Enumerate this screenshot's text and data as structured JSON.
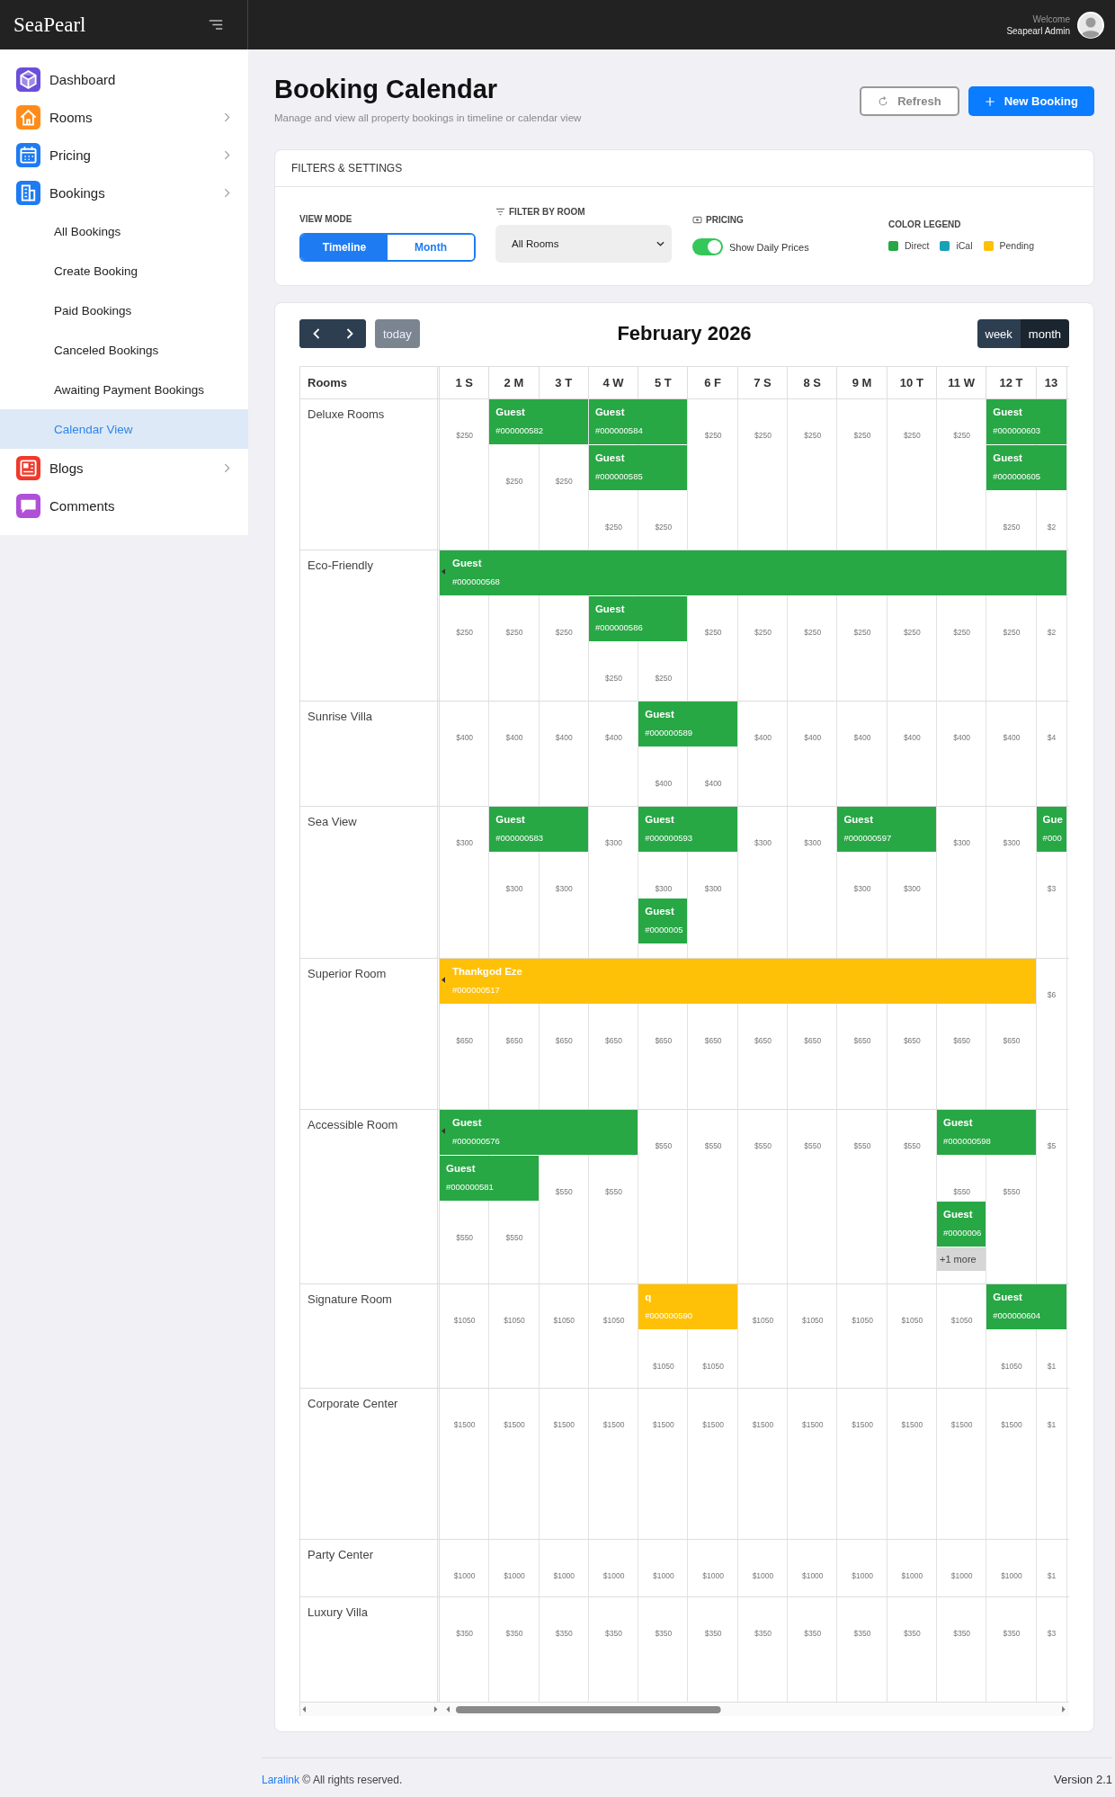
{
  "topbar": {
    "brand": "SeaPearl",
    "welcome": "Welcome",
    "user": "Seapearl Admin"
  },
  "sidebar": {
    "items": [
      {
        "label": "Dashboard",
        "has_children": false
      },
      {
        "label": "Rooms",
        "has_children": true
      },
      {
        "label": "Pricing",
        "has_children": true
      },
      {
        "label": "Bookings",
        "has_children": true,
        "children": [
          {
            "label": "All Bookings",
            "selected": false
          },
          {
            "label": "Create Booking",
            "selected": false
          },
          {
            "label": "Paid Bookings",
            "selected": false
          },
          {
            "label": "Canceled Bookings",
            "selected": false
          },
          {
            "label": "Awaiting Payment Bookings",
            "selected": false
          },
          {
            "label": "Calendar View",
            "selected": true
          }
        ]
      },
      {
        "label": "Blogs",
        "has_children": true
      },
      {
        "label": "Comments",
        "has_children": false
      }
    ]
  },
  "page": {
    "title": "Booking Calendar",
    "subtitle": "Manage and view all property bookings in timeline or calendar view",
    "buttons": [
      {
        "kind": "refresh",
        "label": "Refresh"
      },
      {
        "kind": "new",
        "label": "New Booking"
      }
    ]
  },
  "filters": {
    "title": "FILTERS & SETTINGS",
    "view_mode": {
      "label": "VIEW MODE",
      "tabs": [
        {
          "label": "Timeline",
          "selected": true
        },
        {
          "label": "Month",
          "selected": false
        }
      ]
    },
    "room_filter": {
      "label": "FILTER BY ROOM",
      "value": "All Rooms"
    },
    "pricing": {
      "label": "PRICING",
      "toggle_label": "Show Daily Prices",
      "on": true
    },
    "legend": {
      "label": "COLOR LEGEND",
      "items": [
        {
          "label": "Direct",
          "color": "#28a745"
        },
        {
          "label": "iCal",
          "color": "#17a2b8"
        },
        {
          "label": "Pending",
          "color": "#ffc107"
        }
      ]
    }
  },
  "calendar": {
    "today": "today",
    "title": "February 2026",
    "views": [
      {
        "label": "week",
        "selected": false
      },
      {
        "label": "month",
        "selected": true
      }
    ],
    "rooms_header": "Rooms",
    "days": [
      "1 S",
      "2 M",
      "3 T",
      "4 W",
      "5 T",
      "6 F",
      "7 S",
      "8 S",
      "9 M",
      "10 T",
      "11 W",
      "12 T",
      "13"
    ],
    "rooms": [
      {
        "name": "Deluxe Rooms",
        "bookings": [
          {
            "guest": "Guest",
            "ref": "#000000582",
            "color": "#28a745",
            "continues": false
          },
          {
            "guest": "Guest",
            "ref": "#000000584",
            "color": "#28a745",
            "continues": false
          },
          {
            "guest": "Guest",
            "ref": "#000000585",
            "color": "#28a745",
            "continues": false
          },
          {
            "guest": "Guest",
            "ref": "#000000603",
            "color": "#28a745",
            "continues": false
          },
          {
            "guest": "Guest",
            "ref": "#000000605",
            "color": "#28a745",
            "continues": false
          }
        ],
        "prices": [
          "$250",
          "$250",
          "$250",
          "$250",
          "$250",
          "$250",
          "$250",
          "$250",
          "$250",
          "$250",
          "$250",
          "$250",
          "$2"
        ]
      },
      {
        "name": "Eco-Friendly",
        "bookings": [
          {
            "guest": "Guest",
            "ref": "#000000568",
            "color": "#28a745",
            "continues": true
          },
          {
            "guest": "Guest",
            "ref": "#000000586",
            "color": "#28a745",
            "continues": false
          }
        ],
        "prices": [
          "$250",
          "$250",
          "$250",
          "$250",
          "$250",
          "$250",
          "$250",
          "$250",
          "$250",
          "$250",
          "$250",
          "$250",
          "$2"
        ]
      },
      {
        "name": "Sunrise Villa",
        "bookings": [
          {
            "guest": "Guest",
            "ref": "#000000589",
            "color": "#28a745",
            "continues": false
          }
        ],
        "prices": [
          "$400",
          "$400",
          "$400",
          "$400",
          "$400",
          "$400",
          "$400",
          "$400",
          "$400",
          "$400",
          "$400",
          "$400",
          "$4"
        ]
      },
      {
        "name": "Sea View",
        "bookings": [
          {
            "guest": "Guest",
            "ref": "#000000583",
            "color": "#28a745",
            "continues": false
          },
          {
            "guest": "Guest",
            "ref": "#000000593",
            "color": "#28a745",
            "continues": false
          },
          {
            "guest": "Guest",
            "ref": "#000000597",
            "color": "#28a745",
            "continues": false
          },
          {
            "guest": "Gue",
            "ref": "#000",
            "color": "#28a745",
            "continues": false
          }
        ],
        "prices": [
          "$300",
          "$300",
          "$300",
          "$300",
          "$300",
          "$300",
          "$300",
          "$300",
          "$300",
          "$300",
          "$300",
          "$300",
          "$3"
        ],
        "extra": [
          {
            "kind": "booking",
            "guest": "Guest",
            "ref": "#0000005",
            "color": "#28a745",
            "continues": false
          }
        ]
      },
      {
        "name": "Superior Room",
        "bookings": [
          {
            "guest": "Thankgod Eze",
            "ref": "#000000517",
            "color": "#ffc107",
            "continues": true
          }
        ],
        "prices": [
          "$650",
          "$650",
          "$650",
          "$650",
          "$650",
          "$650",
          "$650",
          "$650",
          "$650",
          "$650",
          "$650",
          "$650",
          "$6"
        ]
      },
      {
        "name": "Accessible Room",
        "bookings": [
          {
            "guest": "Guest",
            "ref": "#000000576",
            "color": "#28a745",
            "continues": true
          },
          {
            "guest": "Guest",
            "ref": "#000000581",
            "color": "#28a745",
            "continues": false
          },
          {
            "guest": "Guest",
            "ref": "#000000598",
            "color": "#28a745",
            "continues": false
          }
        ],
        "prices": [
          "$550",
          "$550",
          "$550",
          "$550",
          "$550",
          "$550",
          "$550",
          "$550",
          "$550",
          "$550",
          "$550",
          "$550",
          "$5"
        ],
        "extra": [
          {
            "kind": "booking",
            "guest": "Guest",
            "ref": "#0000006",
            "color": "#28a745",
            "continues": false
          },
          {
            "kind": "more",
            "label": "+1 more"
          }
        ]
      },
      {
        "name": "Signature Room",
        "bookings": [
          {
            "guest": "q",
            "ref": "#000000590",
            "color": "#ffc107",
            "continues": false
          },
          {
            "guest": "Guest",
            "ref": "#000000604",
            "color": "#28a745",
            "continues": false
          }
        ],
        "prices": [
          "$1050",
          "$1050",
          "$1050",
          "$1050",
          "$1050",
          "$1050",
          "$1050",
          "$1050",
          "$1050",
          "$1050",
          "$1050",
          "$1050",
          "$1"
        ]
      },
      {
        "name": "Corporate Center",
        "prices": [
          "$1500",
          "$1500",
          "$1500",
          "$1500",
          "$1500",
          "$1500",
          "$1500",
          "$1500",
          "$1500",
          "$1500",
          "$1500",
          "$1500",
          "$1"
        ]
      },
      {
        "name": "Party Center",
        "prices": [
          "$1000",
          "$1000",
          "$1000",
          "$1000",
          "$1000",
          "$1000",
          "$1000",
          "$1000",
          "$1000",
          "$1000",
          "$1000",
          "$1000",
          "$1"
        ]
      },
      {
        "name": "Luxury Villa",
        "prices": [
          "$350",
          "$350",
          "$350",
          "$350",
          "$350",
          "$350",
          "$350",
          "$350",
          "$350",
          "$350",
          "$350",
          "$350",
          "$3"
        ]
      }
    ]
  },
  "footer": {
    "link": "Laralink",
    "text": "© All rights reserved.",
    "version": "Version 2.1"
  }
}
